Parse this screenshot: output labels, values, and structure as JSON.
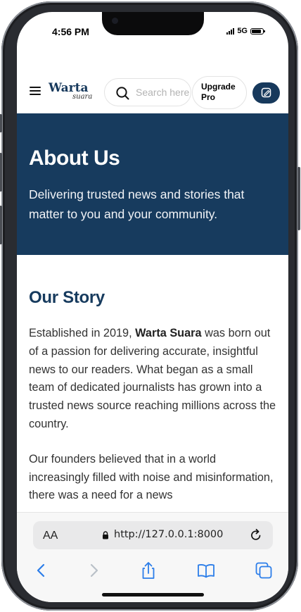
{
  "status_bar": {
    "time": "4:56 PM",
    "network": "5G"
  },
  "header": {
    "logo_main": "Warta",
    "logo_sub": "suara",
    "search_placeholder": "Search here",
    "upgrade_line1": "Upgrade",
    "upgrade_line2": "Pro"
  },
  "hero": {
    "title": "About Us",
    "subtitle": "Delivering trusted news and stories that matter to you and your community."
  },
  "story": {
    "title": "Our Story",
    "p1_before": "Established in 2019, ",
    "p1_brand": "Warta Suara",
    "p1_after": " was born out of a passion for delivering accurate, insightful news to our readers. What began as a small team of dedicated journalists has grown into a trusted news source reaching millions across the country.",
    "p2": "Our founders believed that in a world increasingly filled with noise and misinformation, there was a need for a news"
  },
  "browser": {
    "aa_label": "AA",
    "url": "http://127.0.0.1:8000"
  },
  "colors": {
    "brand_navy": "#173b5e",
    "text": "#333333"
  },
  "icons": [
    "menu-icon",
    "search-icon",
    "edit-icon",
    "lock-icon",
    "reload-icon",
    "back-icon",
    "forward-icon",
    "share-icon",
    "bookmarks-icon",
    "tabs-icon"
  ]
}
